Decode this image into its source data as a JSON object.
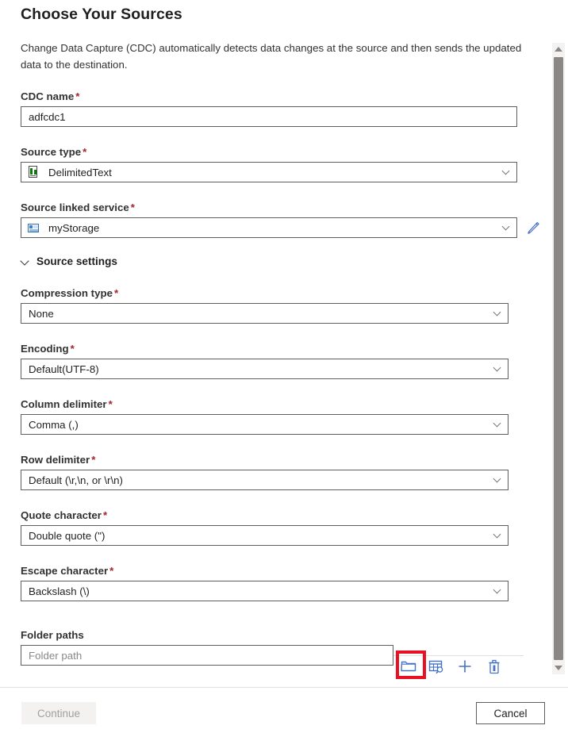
{
  "dialog": {
    "title": "Choose Your Sources",
    "description": "Change Data Capture (CDC) automatically detects data changes at the source and then sends the updated data to the destination."
  },
  "fields": {
    "cdc_name": {
      "label": "CDC name",
      "required": "*",
      "value": "adfcdc1"
    },
    "source_type": {
      "label": "Source type",
      "required": "*",
      "value": "DelimitedText",
      "icon": "delimited-text-icon"
    },
    "source_linked_service": {
      "label": "Source linked service",
      "required": "*",
      "value": "myStorage",
      "icon": "storage-account-icon",
      "edit_icon": "pencil-edit-icon"
    },
    "source_settings_section": {
      "label": "Source settings",
      "expanded": true,
      "chevron": "chevron-down-icon"
    },
    "compression_type": {
      "label": "Compression type",
      "required": "*",
      "value": "None"
    },
    "encoding": {
      "label": "Encoding",
      "required": "*",
      "value": "Default(UTF-8)"
    },
    "column_delimiter": {
      "label": "Column delimiter",
      "required": "*",
      "value": "Comma (,)"
    },
    "row_delimiter": {
      "label": "Row delimiter",
      "required": "*",
      "value": "Default (\\r,\\n, or \\r\\n)"
    },
    "quote_character": {
      "label": "Quote character",
      "required": "*",
      "value": "Double quote (\")"
    },
    "escape_character": {
      "label": "Escape character",
      "required": "*",
      "value": "Backslash (\\)"
    },
    "folder_paths": {
      "label": "Folder paths",
      "placeholder": "Folder path",
      "value": "",
      "actions": [
        {
          "name": "browse-folder-icon",
          "title": "Browse",
          "highlighted": true
        },
        {
          "name": "preview-data-icon",
          "title": "Preview data",
          "highlighted": false
        },
        {
          "name": "add-icon",
          "title": "Add",
          "highlighted": false
        },
        {
          "name": "delete-icon",
          "title": "Delete",
          "highlighted": false
        }
      ]
    }
  },
  "footer": {
    "continue_label": "Continue",
    "continue_disabled": true,
    "cancel_label": "Cancel"
  },
  "scrollbar": {
    "up_arrow": "scroll-up-arrow-icon",
    "down_arrow": "scroll-down-arrow-icon",
    "thumb": "scrollbar-thumb"
  },
  "colors": {
    "accent": "#0078d4",
    "icon_blue": "#4472c4",
    "required_red": "#a4262c",
    "highlight_red": "#e81123",
    "border": "#605e5c",
    "disabled_text": "#a19f9d"
  }
}
